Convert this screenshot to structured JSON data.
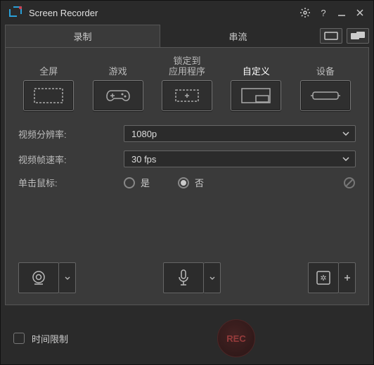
{
  "title": "Screen Recorder",
  "tabs": {
    "record": "录制",
    "stream": "串流"
  },
  "modes": {
    "fullscreen": "全屏",
    "game": "游戏",
    "lockapp": "锁定到\n应用程序",
    "custom": "自定义",
    "device": "设备"
  },
  "settings": {
    "resolution_label": "视频分辨率:",
    "resolution_value": "1080p",
    "framerate_label": "视频帧速率:",
    "framerate_value": "30 fps",
    "click_label": "单击鼠标:",
    "click_yes": "是",
    "click_no": "否"
  },
  "footer": {
    "timelimit": "时间限制",
    "rec": "REC"
  }
}
